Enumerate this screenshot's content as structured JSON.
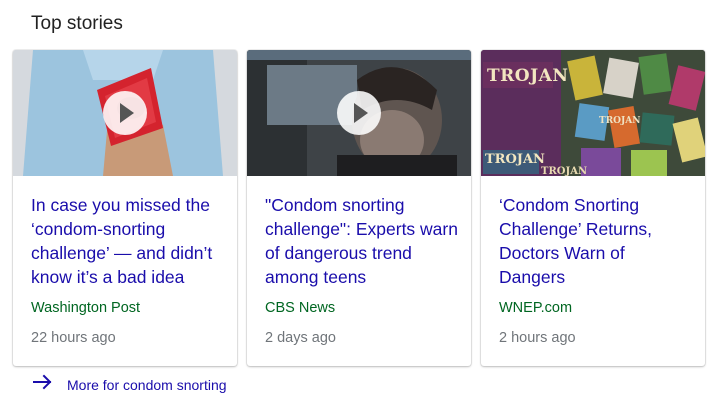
{
  "section": {
    "title": "Top stories"
  },
  "stories": [
    {
      "headline": "In case you missed the ‘condom-snorting challenge’ — and didn’t know it’s a bad idea",
      "source": "Washington Post",
      "time": "22 hours ago",
      "has_video": true
    },
    {
      "headline": "\"Condom snorting challenge\": Experts warn of dangerous trend among teens",
      "source": "CBS News",
      "time": "2 days ago",
      "has_video": true
    },
    {
      "headline": "‘Condom Snorting Challenge’ Returns, Doctors Warn of Dangers",
      "source": "WNEP.com",
      "time": "2 hours ago",
      "has_video": false,
      "thumbnail_text": [
        "TROJAN",
        "TROJAN",
        "TROJAN",
        "TROJAN"
      ]
    }
  ],
  "more_link": {
    "label": "More for condom snorting",
    "icon": "arrow-right-icon"
  },
  "colors": {
    "headline": "#1a0dab",
    "source": "#006621",
    "time": "#70757a"
  }
}
